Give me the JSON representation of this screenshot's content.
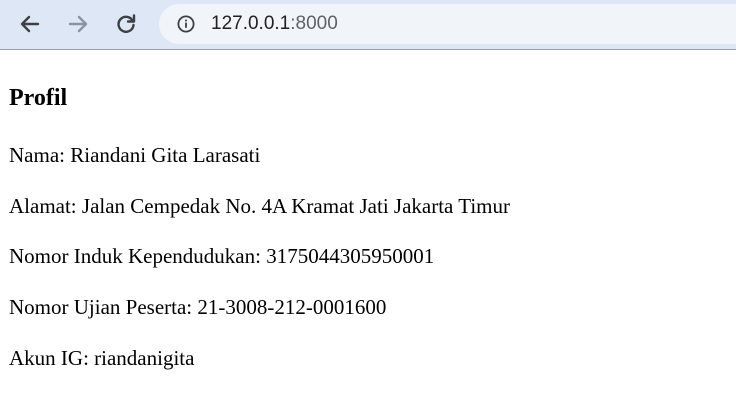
{
  "browser": {
    "url_host": "127.0.0.1",
    "url_port": ":8000",
    "icons": {
      "back": "arrow-left-icon",
      "forward": "arrow-right-icon",
      "reload": "reload-icon",
      "info": "info-icon"
    },
    "colors": {
      "toolbar_bg": "#dee7f5",
      "omnibox_bg": "#f1f4f9",
      "icon_active": "#3c4043",
      "icon_disabled": "#8a93a0"
    }
  },
  "page": {
    "title": "Profil",
    "fields": [
      {
        "text": "Nama: Riandani Gita Larasati"
      },
      {
        "text": "Alamat: Jalan Cempedak No. 4A Kramat Jati Jakarta Timur"
      },
      {
        "text": "Nomor Induk Kependudukan: 3175044305950001"
      },
      {
        "text": "Nomor Ujian Peserta: 21-3008-212-0001600"
      },
      {
        "text": "Akun IG: riandanigita"
      }
    ]
  }
}
